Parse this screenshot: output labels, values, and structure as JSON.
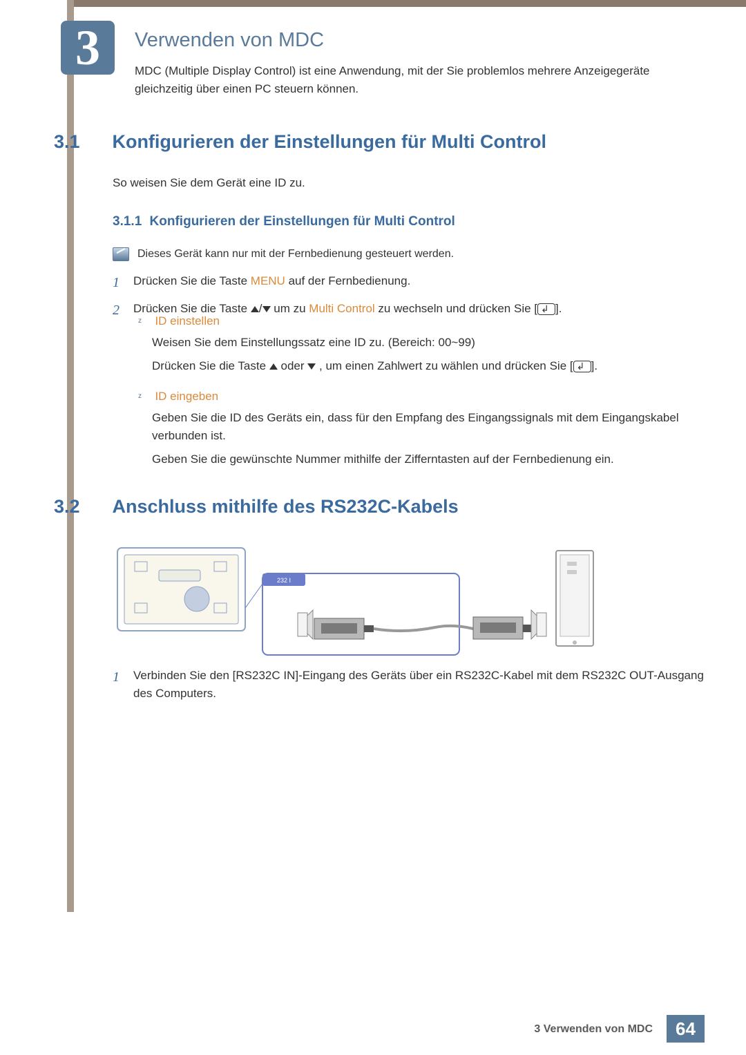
{
  "chapter": {
    "number": "3",
    "title": "Verwenden von MDC",
    "desc": "MDC (Multiple Display Control) ist eine Anwendung, mit der Sie problemlos mehrere Anzeigegeräte gleichzeitig über einen PC steuern können."
  },
  "sec31": {
    "num": "3.1",
    "title": "Konfigurieren der Einstellungen für Multi Control",
    "intro": "So weisen Sie dem Gerät eine ID zu."
  },
  "sub311": {
    "num": "3.1.1",
    "title": "Konfigurieren der Einstellungen für Multi Control",
    "note": "Dieses Gerät kann nur mit der Fernbedienung gesteuert werden.",
    "step1": {
      "pre": "Drücken Sie die Taste ",
      "menu": "MENU",
      "post": " auf der Fernbedienung."
    },
    "step2": {
      "pre": "Drücken Sie die Taste ",
      "mid": " um zu ",
      "mc": "Multi Control",
      "post": " zu wechseln und drücken Sie [",
      "post2": "]."
    },
    "sub_a": {
      "label": "ID einstellen",
      "l1": "Weisen Sie dem Einstellungssatz eine ID zu. (Bereich: 00~99)",
      "l2a": "Drücken Sie die Taste ",
      "l2b": " oder ",
      "l2c": ", um einen Zahlwert zu wählen und drücken Sie [",
      "l2d": "]."
    },
    "sub_b": {
      "label": "ID eingeben",
      "l1": "Geben Sie die ID des Geräts ein, dass für den Empfang des Eingangssignals mit dem Eingangskabel verbunden ist.",
      "l2": "Geben Sie die gewünschte Nummer mithilfe der Zifferntasten auf der Fernbedienung ein."
    }
  },
  "sec32": {
    "num": "3.2",
    "title": "Anschluss mithilfe des RS232C-Kabels",
    "step1": "Verbinden Sie den [RS232C IN]-Eingang des Geräts über ein RS232C-Kabel mit dem RS232C OUT-Ausgang des Computers.",
    "diagram": {
      "port_label": "232    I"
    }
  },
  "footer": {
    "chapter": "3 Verwenden von MDC",
    "page": "64"
  },
  "markers": {
    "z": "z",
    "slash": "/"
  }
}
